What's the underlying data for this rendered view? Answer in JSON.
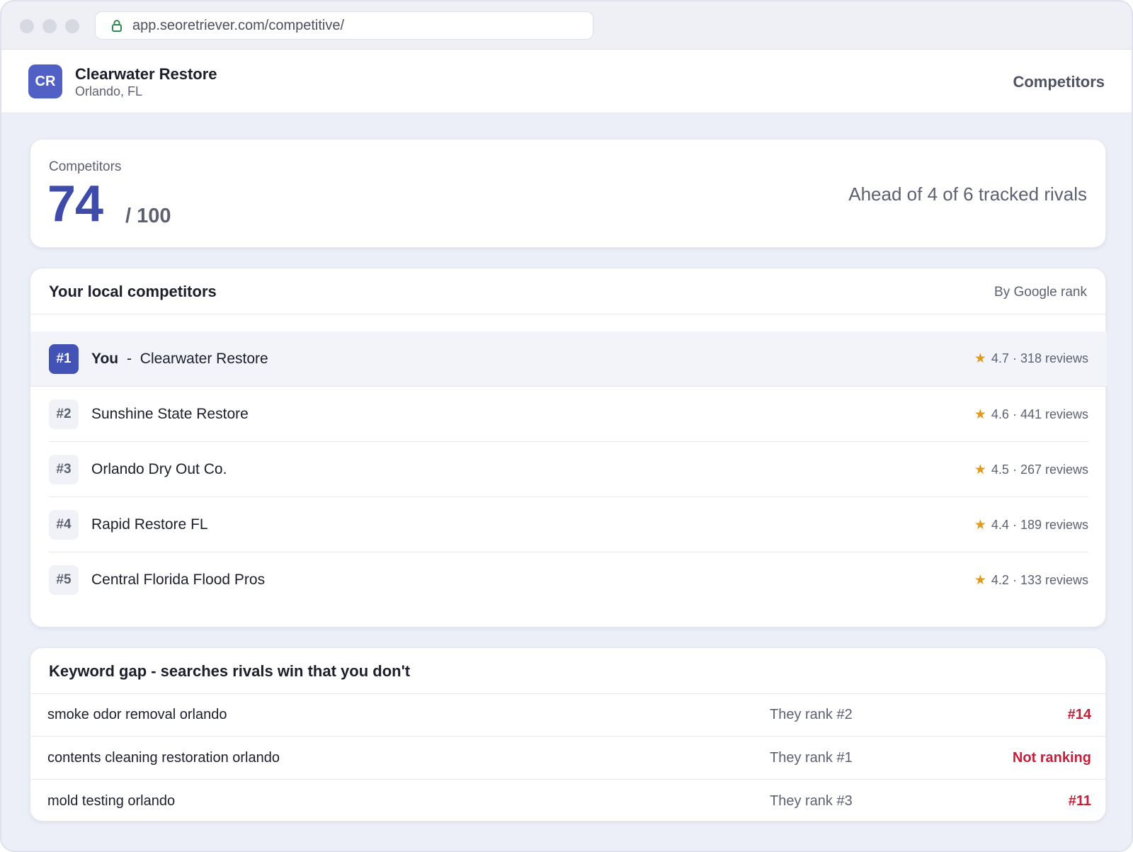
{
  "browser": {
    "url": "app.seoretriever.com/competitive/"
  },
  "header": {
    "logo_text": "CR",
    "business_name": "Clearwater Restore",
    "location": "Orlando, FL",
    "nav_label": "Competitors"
  },
  "score": {
    "label": "Competitors",
    "value": "74",
    "max": "/ 100",
    "summary": "Ahead of 4 of 6 tracked rivals"
  },
  "competitors": {
    "title": "Your local competitors",
    "sort_label": "By Google rank",
    "you_label": "You",
    "you_separator": "-",
    "rows": [
      {
        "rank": "#1",
        "name": "Clearwater Restore",
        "rating": "4.7 · 318 reviews",
        "is_you": true
      },
      {
        "rank": "#2",
        "name": "Sunshine State Restore",
        "rating": "4.6 · 441 reviews",
        "is_you": false
      },
      {
        "rank": "#3",
        "name": "Orlando Dry Out Co.",
        "rating": "4.5 · 267 reviews",
        "is_you": false
      },
      {
        "rank": "#4",
        "name": "Rapid Restore FL",
        "rating": "4.4 · 189 reviews",
        "is_you": false
      },
      {
        "rank": "#5",
        "name": "Central Florida Flood Pros",
        "rating": "4.2 · 133 reviews",
        "is_you": false
      }
    ]
  },
  "keyword_gap": {
    "title": "Keyword gap - searches rivals win that you don't",
    "rows": [
      {
        "term": "smoke odor removal orlando",
        "they_rank": "They rank #2",
        "your_rank": "#14"
      },
      {
        "term": "contents cleaning restoration orlando",
        "they_rank": "They rank #1",
        "your_rank": "Not ranking"
      },
      {
        "term": "mold testing orlando",
        "they_rank": "They rank #3",
        "your_rank": "#11"
      }
    ]
  },
  "colors": {
    "accent": "#4352b5",
    "star": "#e09b1a",
    "negative": "#c4203a",
    "page_bg": "#eceff8"
  },
  "icons": {
    "lock": "lock-icon",
    "star": "star-icon"
  }
}
